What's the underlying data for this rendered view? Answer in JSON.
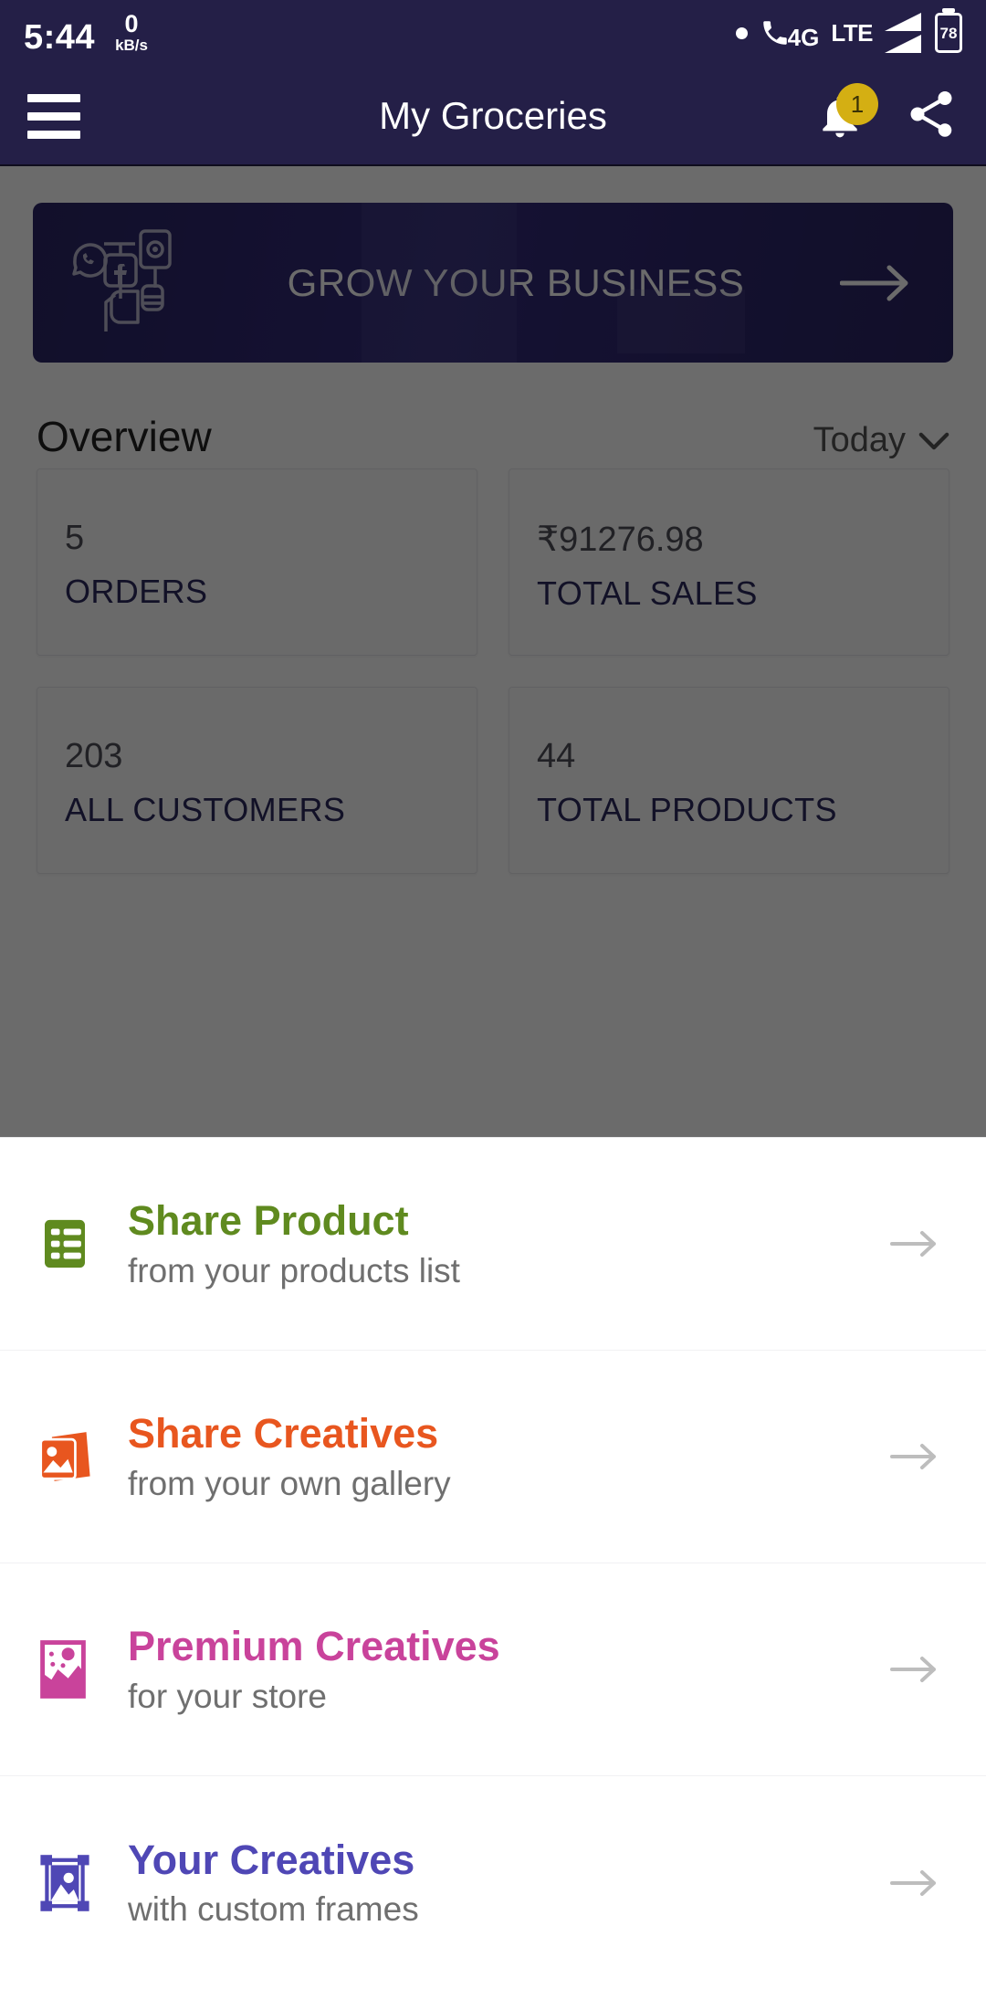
{
  "status_bar": {
    "time": "5:44",
    "net_speed_value": "0",
    "net_speed_unit": "kB/s",
    "network_type": "4G",
    "network_label": "LTE",
    "battery_percent": "78"
  },
  "app_bar": {
    "title": "My Groceries",
    "notification_badge": "1"
  },
  "promo_banner": {
    "text": "GROW YOUR BUSINESS"
  },
  "overview": {
    "title": "Overview",
    "period_label": "Today",
    "cards": [
      {
        "value": "5",
        "label": "ORDERS"
      },
      {
        "value": "₹91276.98",
        "label": "TOTAL SALES"
      },
      {
        "value": "203",
        "label": "ALL CUSTOMERS"
      },
      {
        "value": "44",
        "label": "TOTAL PRODUCTS"
      }
    ]
  },
  "bottom_sheet": {
    "items": [
      {
        "title": "Share Product",
        "subtitle": "from your products list",
        "color": "#5f8a1f"
      },
      {
        "title": "Share Creatives",
        "subtitle": "from your own gallery",
        "color": "#e8561f"
      },
      {
        "title": "Premium Creatives",
        "subtitle": "for your store",
        "color": "#c9439b"
      },
      {
        "title": "Your Creatives",
        "subtitle": "with custom frames",
        "color": "#4f47b5"
      }
    ]
  },
  "colors": {
    "app_bar": "#241f47",
    "banner": "#2b2566",
    "badge": "#d4af13",
    "stat_label": "#2c2a5e"
  }
}
